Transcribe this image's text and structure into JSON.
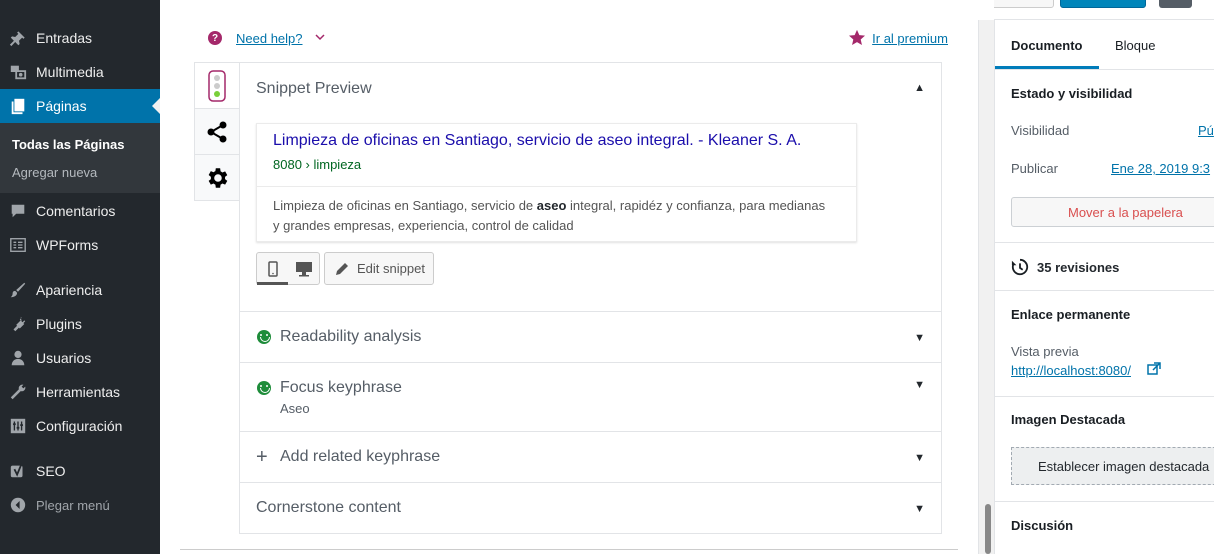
{
  "sidebar": {
    "items": [
      {
        "label": "Entradas",
        "icon": "pin-icon"
      },
      {
        "label": "Multimedia",
        "icon": "media-icon"
      },
      {
        "label": "Páginas",
        "icon": "pages-icon"
      },
      {
        "label": "Comentarios",
        "icon": "comment-icon"
      },
      {
        "label": "WPForms",
        "icon": "forms-icon"
      },
      {
        "label": "Apariencia",
        "icon": "brush-icon"
      },
      {
        "label": "Plugins",
        "icon": "plug-icon"
      },
      {
        "label": "Usuarios",
        "icon": "user-icon"
      },
      {
        "label": "Herramientas",
        "icon": "wrench-icon"
      },
      {
        "label": "Configuración",
        "icon": "settings-icon"
      },
      {
        "label": "SEO",
        "icon": "yoast-icon"
      }
    ],
    "submenu": {
      "all_pages": "Todas las Páginas",
      "add_new": "Agregar nueva"
    },
    "collapse": "Plegar menú",
    "accent_color": "#0073aa"
  },
  "help": {
    "need_help": "Need help?",
    "premium": "Ir al premium"
  },
  "yoast": {
    "snippet_preview": "Snippet Preview",
    "snippet": {
      "title": "Limpieza de oficinas en Santiago, servicio de aseo integral. - Kleaner S. A.",
      "url": "8080 › limpieza",
      "desc_before": "Limpieza de oficinas en Santiago, servicio de ",
      "desc_bold": "aseo",
      "desc_after": " integral, rapidéz y confianza, para medianas y grandes empresas, experiencia, control de calidad"
    },
    "edit_snippet": "Edit snippet",
    "readability": "Readability analysis",
    "focus_keyphrase": "Focus keyphrase",
    "focus_value": "Aseo",
    "related_keyphrase": "Add related keyphrase",
    "cornerstone": "Cornerstone content",
    "good_color": "#1e8c3a"
  },
  "settings": {
    "tabs": {
      "document": "Documento",
      "block": "Bloque"
    },
    "status_title": "Estado y visibilidad",
    "visibility_label": "Visibilidad",
    "visibility_value": "Pú",
    "publish_label": "Publicar",
    "publish_value": "Ene 28, 2019 9:3",
    "trash": "Mover a la papelera",
    "revisions": "35 revisiones",
    "permalink_title": "Enlace permanente",
    "preview_label": "Vista previa",
    "preview_url": "http://localhost:8080/",
    "featured_title": "Imagen Destacada",
    "featured_button": "Establecer imagen destacada",
    "discussion_title": "Discusión"
  }
}
